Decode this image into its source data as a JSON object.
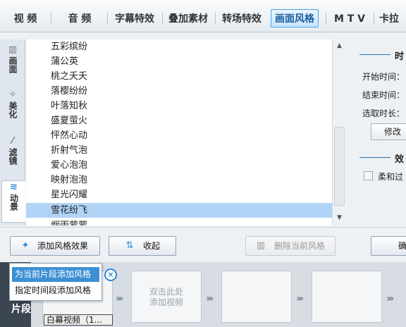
{
  "tabs": [
    {
      "label": "视 频"
    },
    {
      "label": "音 频"
    },
    {
      "label": "字幕特效"
    },
    {
      "label": "叠加素材"
    },
    {
      "label": "转场特效"
    },
    {
      "label": "画面风格",
      "active": true
    },
    {
      "label": "M T V"
    },
    {
      "label": "卡拉"
    }
  ],
  "side_tabs": [
    {
      "label": "画面",
      "icon": "filmstrip-icon"
    },
    {
      "label": "美化",
      "icon": "magic-wand-icon"
    },
    {
      "label": "滤镜",
      "icon": "filter-wand-icon"
    },
    {
      "label": "动景",
      "icon": "wave-icon",
      "active": true
    }
  ],
  "style_list": {
    "items": [
      "五彩缤纷",
      "蒲公英",
      "桃之夭夭",
      "落樱纷纷",
      "叶落知秋",
      "盛夏萤火",
      "怦然心动",
      "折射气泡",
      "爱心泡泡",
      "映射泡泡",
      "星光闪耀",
      "雪花纷飞",
      "烟雨蒙蒙"
    ],
    "selected": "雪花纷飞"
  },
  "right_panel": {
    "section_time": "时",
    "start_time_label": "开始时间：",
    "end_time_label": "结束时间：",
    "duration_label": "选取时长：",
    "modify_button": "修改",
    "section_effect": "效",
    "soft_checkbox_label": "柔和过"
  },
  "toolbar": {
    "add_style": "添加风格效果",
    "collapse": "收起",
    "delete_style": "删除当前风格",
    "confirm": "确"
  },
  "popup": {
    "items": [
      "为当前片段添加风格",
      "指定时间段添加风格"
    ],
    "hovered": "为当前片段添加风格",
    "close": "×"
  },
  "track": {
    "segment_label": "片段",
    "clip_caption": "白幕视频（1...",
    "empty_slot_text": "双击此处添加视频"
  },
  "colors": {
    "accent": "#2d8ad6",
    "selection": "#b0d4f6",
    "menu_highlight": "#3d8fd4"
  }
}
